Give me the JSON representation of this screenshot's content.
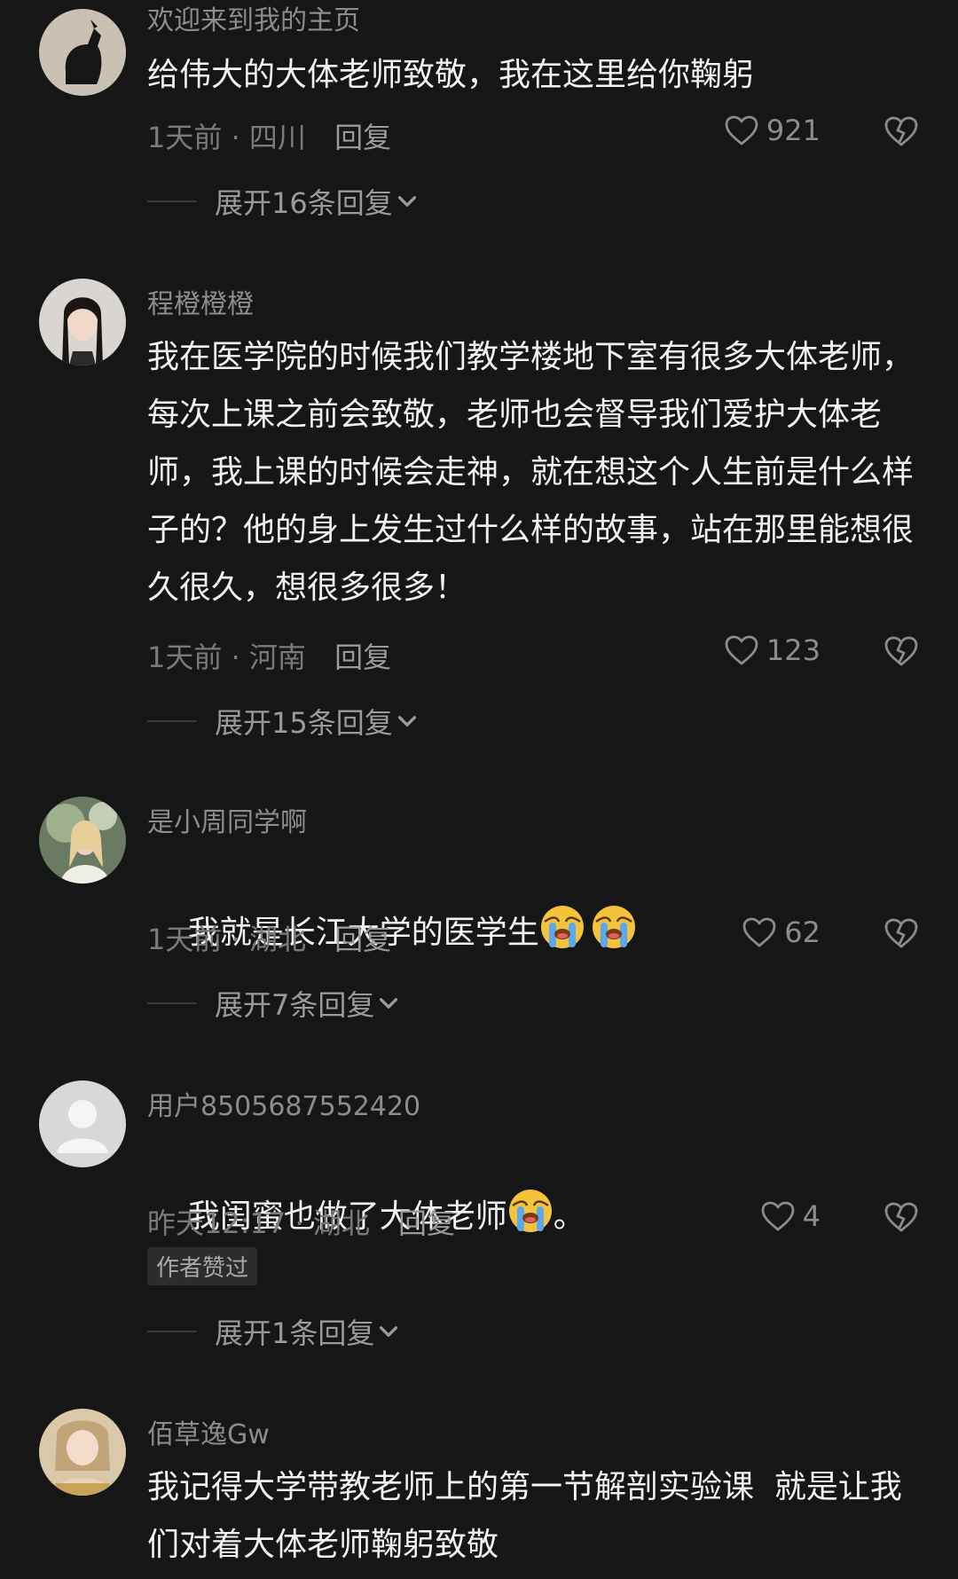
{
  "comments": [
    {
      "username": "欢迎来到我的主页",
      "text": "给伟大的大体老师致敬，我在这里给你鞠躬",
      "time": "1天前",
      "location": "四川",
      "reply_label": "回复",
      "likes": "921",
      "expand_label": "展开16条回复"
    },
    {
      "username": "程橙橙橙",
      "text": "我在医学院的时候我们教学楼地下室有很多大体老师，每次上课之前会致敬，老师也会督导我们爱护大体老师，我上课的时候会走神，就在想这个人生前是什么样子的？他的身上发生过什么样的故事，站在那里能想很久很久，想很多很多！",
      "time": "1天前",
      "location": "河南",
      "reply_label": "回复",
      "likes": "123",
      "expand_label": "展开15条回复"
    },
    {
      "username": "是小周同学啊",
      "text": "我就是长江大学的医学生",
      "emoji_count": 2,
      "time": "1天前",
      "location": "湖北",
      "reply_label": "回复",
      "likes": "62",
      "expand_label": "展开7条回复"
    },
    {
      "username": "用户8505687552420",
      "text_before": "我闺蜜也做了大体老师",
      "text_after": "。",
      "time": "昨天12:17",
      "location": "湖北",
      "reply_label": "回复",
      "likes": "4",
      "badge": "作者赞过",
      "expand_label": "展开1条回复"
    },
    {
      "username": "佰草逸Gw",
      "text": "我记得大学带教老师上的第一节解剖实验课  就是让我们对着大体老师鞠躬致敬"
    }
  ],
  "separator": "·",
  "colors": {
    "background": "#161616",
    "text": "#f2f2f2",
    "muted": "#8c8c8c"
  },
  "icons": {
    "like": "heart-outline-icon",
    "dislike": "broken-heart-icon",
    "expand": "chevron-down-icon",
    "emoji": "loudly-crying-face-emoji"
  }
}
